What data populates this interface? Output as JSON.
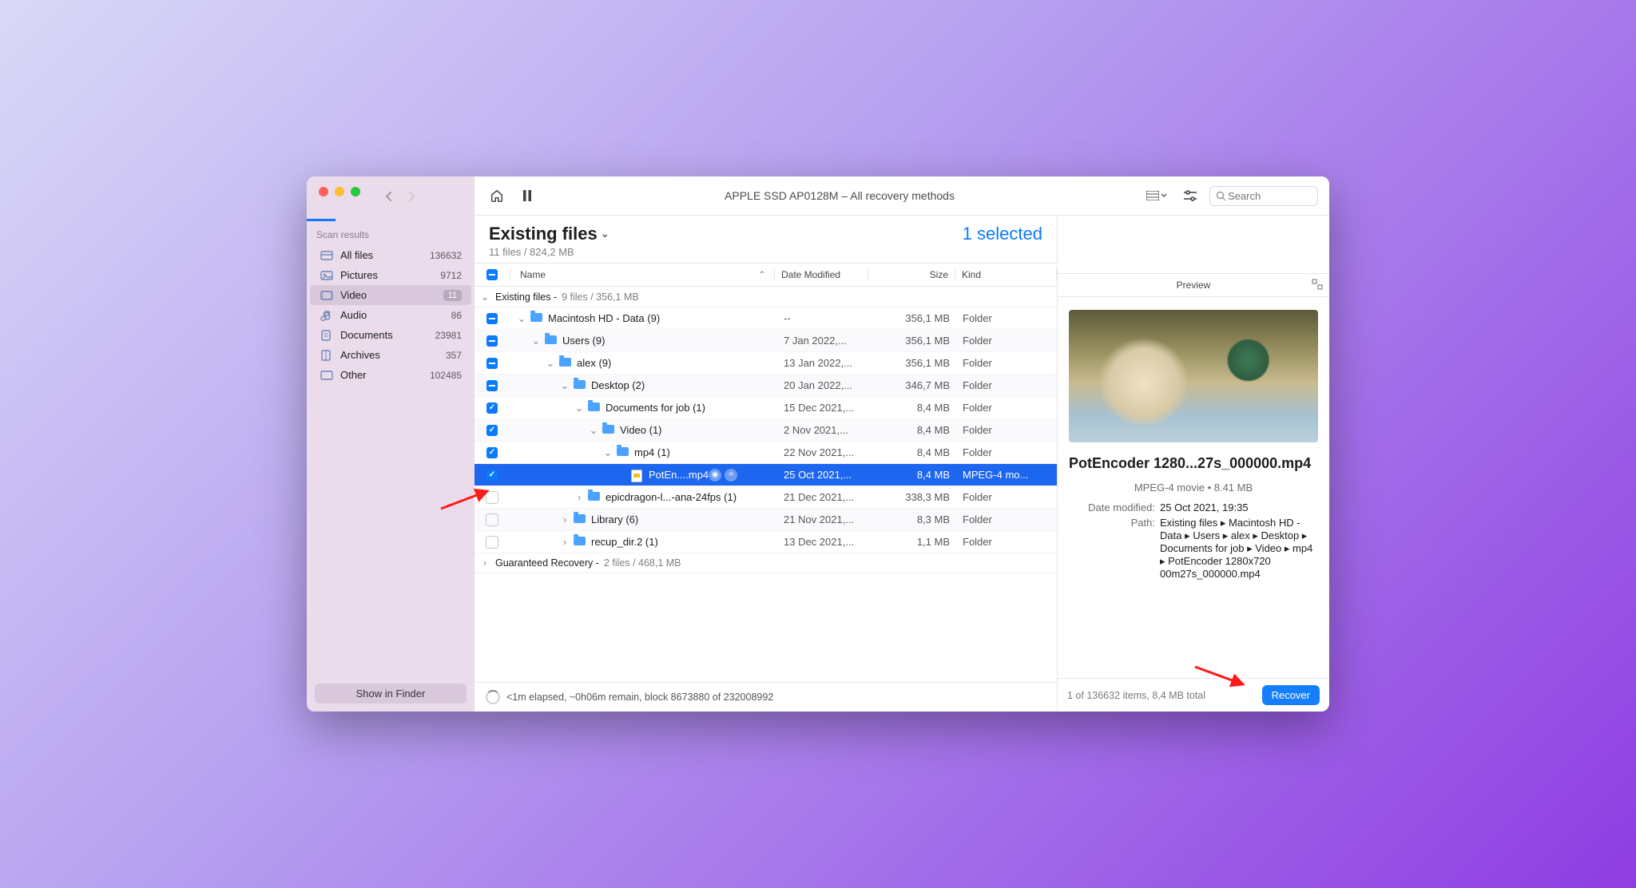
{
  "window_title": "APPLE SSD AP0128M – All recovery methods",
  "search_placeholder": "Search",
  "sidebar": {
    "section_title": "Scan results",
    "items": [
      {
        "icon": "all-files-icon",
        "label": "All files",
        "count": "136632",
        "selected": false
      },
      {
        "icon": "pictures-icon",
        "label": "Pictures",
        "count": "9712",
        "selected": false
      },
      {
        "icon": "video-icon",
        "label": "Video",
        "count": "11",
        "selected": true,
        "badge": true
      },
      {
        "icon": "audio-icon",
        "label": "Audio",
        "count": "86",
        "selected": false
      },
      {
        "icon": "documents-icon",
        "label": "Documents",
        "count": "23981",
        "selected": false
      },
      {
        "icon": "archives-icon",
        "label": "Archives",
        "count": "357",
        "selected": false
      },
      {
        "icon": "other-icon",
        "label": "Other",
        "count": "102485",
        "selected": false
      }
    ],
    "footer_button": "Show in Finder"
  },
  "heading": {
    "title": "Existing files",
    "subtitle": "11 files / 824,2 MB",
    "selection": "1 selected"
  },
  "columns": {
    "name": "Name",
    "date": "Date Modified",
    "size": "Size",
    "kind": "Kind",
    "preview": "Preview"
  },
  "groups": [
    {
      "name": "Existing files -",
      "info": "9 files / 356,1 MB",
      "expanded": true
    },
    {
      "name": "Guaranteed Recovery -",
      "info": "2 files / 468,1 MB",
      "expanded": false
    }
  ],
  "rows": [
    {
      "depth": 0,
      "cb": "mixed",
      "disc": "down",
      "icon": "folder",
      "name": "Macintosh HD - Data (9)",
      "date": "--",
      "size": "356,1 MB",
      "kind": "Folder"
    },
    {
      "depth": 1,
      "cb": "mixed",
      "disc": "down",
      "icon": "folder",
      "name": "Users (9)",
      "date": "7 Jan 2022,...",
      "size": "356,1 MB",
      "kind": "Folder"
    },
    {
      "depth": 2,
      "cb": "mixed",
      "disc": "down",
      "icon": "folder",
      "name": "alex (9)",
      "date": "13 Jan 2022,...",
      "size": "356,1 MB",
      "kind": "Folder"
    },
    {
      "depth": 3,
      "cb": "mixed",
      "disc": "down",
      "icon": "folder",
      "name": "Desktop (2)",
      "date": "20 Jan 2022,...",
      "size": "346,7 MB",
      "kind": "Folder"
    },
    {
      "depth": 4,
      "cb": "checked",
      "disc": "down",
      "icon": "folder",
      "name": "Documents for job (1)",
      "date": "15 Dec 2021,...",
      "size": "8,4 MB",
      "kind": "Folder"
    },
    {
      "depth": 5,
      "cb": "checked",
      "disc": "down",
      "icon": "folder",
      "name": "Video (1)",
      "date": "2 Nov 2021,...",
      "size": "8,4 MB",
      "kind": "Folder"
    },
    {
      "depth": 6,
      "cb": "checked",
      "disc": "down",
      "icon": "folder",
      "name": "mp4 (1)",
      "date": "22 Nov 2021,...",
      "size": "8,4 MB",
      "kind": "Folder"
    },
    {
      "depth": 7,
      "cb": "checked",
      "disc": "none",
      "icon": "file",
      "name": "PotEn....mp4",
      "date": "25 Oct 2021,...",
      "size": "8,4 MB",
      "kind": "MPEG-4 mo...",
      "selected": true,
      "actions": true
    },
    {
      "depth": 4,
      "cb": "empty",
      "disc": "right",
      "icon": "folder",
      "name": "epicdragon-l...-ana-24fps (1)",
      "date": "21 Dec 2021,...",
      "size": "338,3 MB",
      "kind": "Folder"
    },
    {
      "depth": 3,
      "cb": "empty",
      "disc": "right",
      "icon": "folder",
      "name": "Library (6)",
      "date": "21 Nov 2021,...",
      "size": "8,3 MB",
      "kind": "Folder"
    },
    {
      "depth": 3,
      "cb": "empty",
      "disc": "right",
      "icon": "folder",
      "name": "recup_dir.2 (1)",
      "date": "13 Dec 2021,...",
      "size": "1,1 MB",
      "kind": "Folder"
    }
  ],
  "status": "<1m elapsed, ~0h06m remain, block 8673880 of 232008992",
  "preview": {
    "filename": "PotEncoder 1280...27s_000000.mp4",
    "meta": "MPEG-4 movie • 8.41 MB",
    "date_label": "Date modified:",
    "date_value": "25 Oct 2021, 19:35",
    "path_label": "Path:",
    "path_value": "Existing files ▸ Macintosh HD - Data ▸ Users ▸ alex ▸ Desktop ▸ Documents for job ▸ Video ▸ mp4 ▸ PotEncoder 1280x720 00m27s_000000.mp4"
  },
  "footer": {
    "summary": "1 of 136632 items, 8,4 MB total",
    "button": "Recover"
  }
}
